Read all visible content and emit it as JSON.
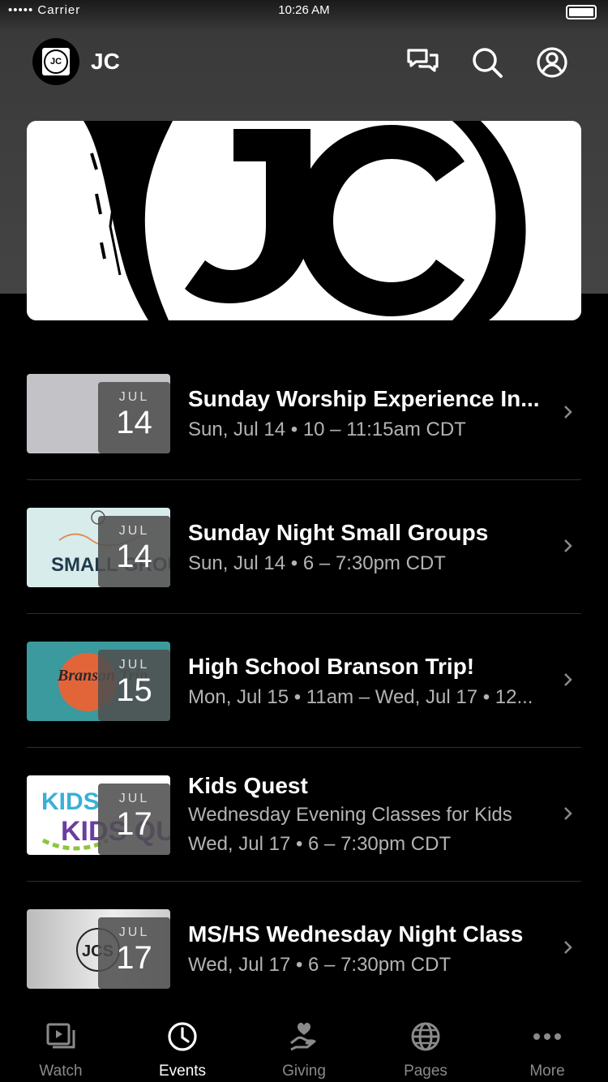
{
  "status": {
    "carrier": "••••• Carrier",
    "time": "10:26 AM"
  },
  "header": {
    "title": "JC",
    "logo_text": "JC"
  },
  "events": [
    {
      "title": "Sunday Worship Experience In...",
      "subtitle": "Sun, Jul 14 • 10 – 11:15am CDT",
      "subtitle2": "",
      "month": "JUL",
      "day": "14",
      "thumb_bg": "#c3c3c7",
      "thumb_text": ""
    },
    {
      "title": "Sunday Night Small Groups",
      "subtitle": "Sun, Jul 14 • 6 – 7:30pm CDT",
      "subtitle2": "",
      "month": "JUL",
      "day": "14",
      "thumb_bg": "#d9ecec",
      "thumb_text": "SMALL GROUPS"
    },
    {
      "title": "High School Branson Trip!",
      "subtitle": "Mon, Jul 15 • 11am – Wed, Jul 17 • 12...",
      "subtitle2": "",
      "month": "JUL",
      "day": "15",
      "thumb_bg": "#3a9a9e",
      "thumb_text": "Branson Trip"
    },
    {
      "title": "Kids Quest",
      "subtitle": "Wednesday Evening Classes for Kids",
      "subtitle2": "Wed, Jul 17 • 6 – 7:30pm CDT",
      "month": "JUL",
      "day": "17",
      "thumb_bg": "#ffffff",
      "thumb_text": "KIDS QUEST"
    },
    {
      "title": "MS/HS Wednesday Night Class",
      "subtitle": "Wed, Jul 17 • 6 – 7:30pm CDT",
      "subtitle2": "",
      "month": "JUL",
      "day": "17",
      "thumb_bg": "#e2e2e2",
      "thumb_text": "JCS"
    }
  ],
  "tabs": [
    {
      "label": "Watch",
      "icon": "watch-icon"
    },
    {
      "label": "Events",
      "icon": "clock-icon"
    },
    {
      "label": "Giving",
      "icon": "giving-icon"
    },
    {
      "label": "Pages",
      "icon": "globe-icon"
    },
    {
      "label": "More",
      "icon": "more-icon"
    }
  ],
  "colors": {
    "active_tab": "#ffffff",
    "inactive_tab": "#8a8a8a",
    "header_bg": "#444444"
  }
}
